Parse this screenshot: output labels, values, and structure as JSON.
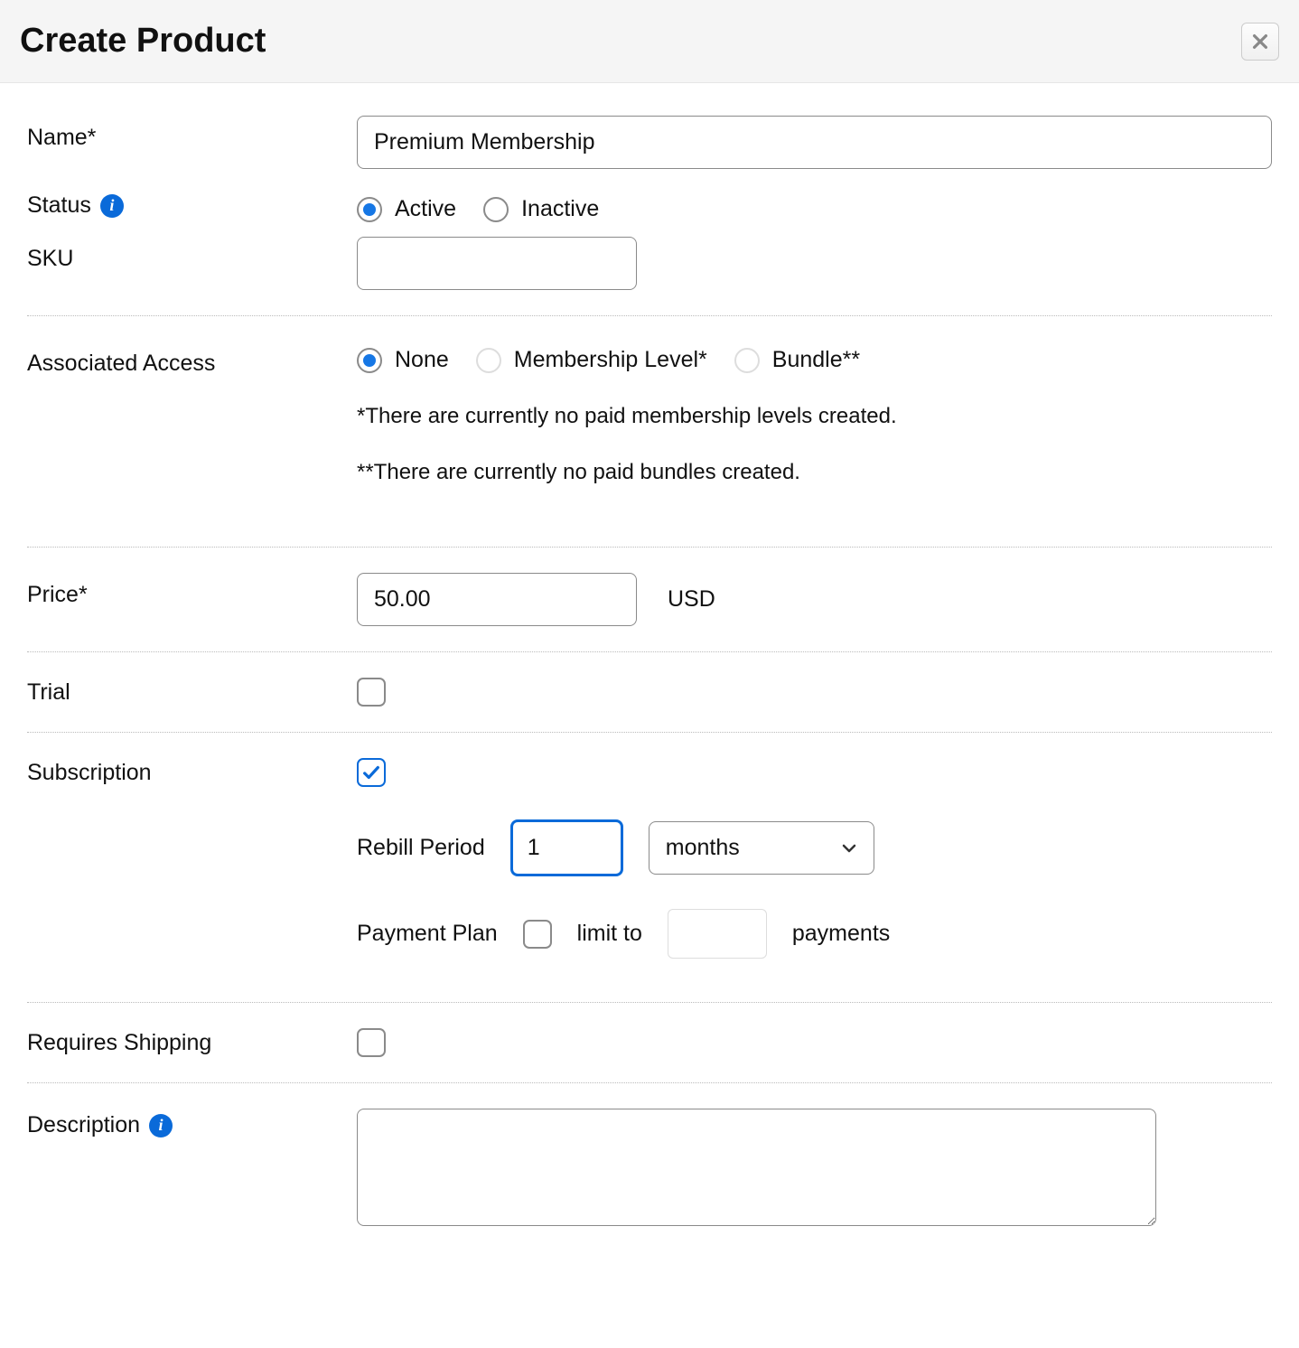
{
  "header": {
    "title": "Create Product"
  },
  "fields": {
    "name": {
      "label": "Name*",
      "value": "Premium Membership"
    },
    "status": {
      "label": "Status",
      "opt_active": "Active",
      "opt_inactive": "Inactive",
      "selected": "Active"
    },
    "sku": {
      "label": "SKU",
      "value": ""
    },
    "access": {
      "label": "Associated Access",
      "opt_none": "None",
      "opt_membership": "Membership Level*",
      "opt_bundle": "Bundle**",
      "selected": "None",
      "note_membership": "*There are currently no paid membership levels created.",
      "note_bundle": "**There are currently no paid bundles created."
    },
    "price": {
      "label": "Price*",
      "value": "50.00",
      "currency": "USD"
    },
    "trial": {
      "label": "Trial",
      "checked": false
    },
    "subscription": {
      "label": "Subscription",
      "checked": true,
      "rebill_label": "Rebill Period",
      "rebill_value": "1",
      "rebill_unit": "months",
      "plan_label": "Payment Plan",
      "plan_limit_prefix": "limit to",
      "plan_limit_value": "",
      "plan_limit_suffix": "payments",
      "plan_checked": false
    },
    "shipping": {
      "label": "Requires Shipping",
      "checked": false
    },
    "description": {
      "label": "Description",
      "value": ""
    }
  }
}
